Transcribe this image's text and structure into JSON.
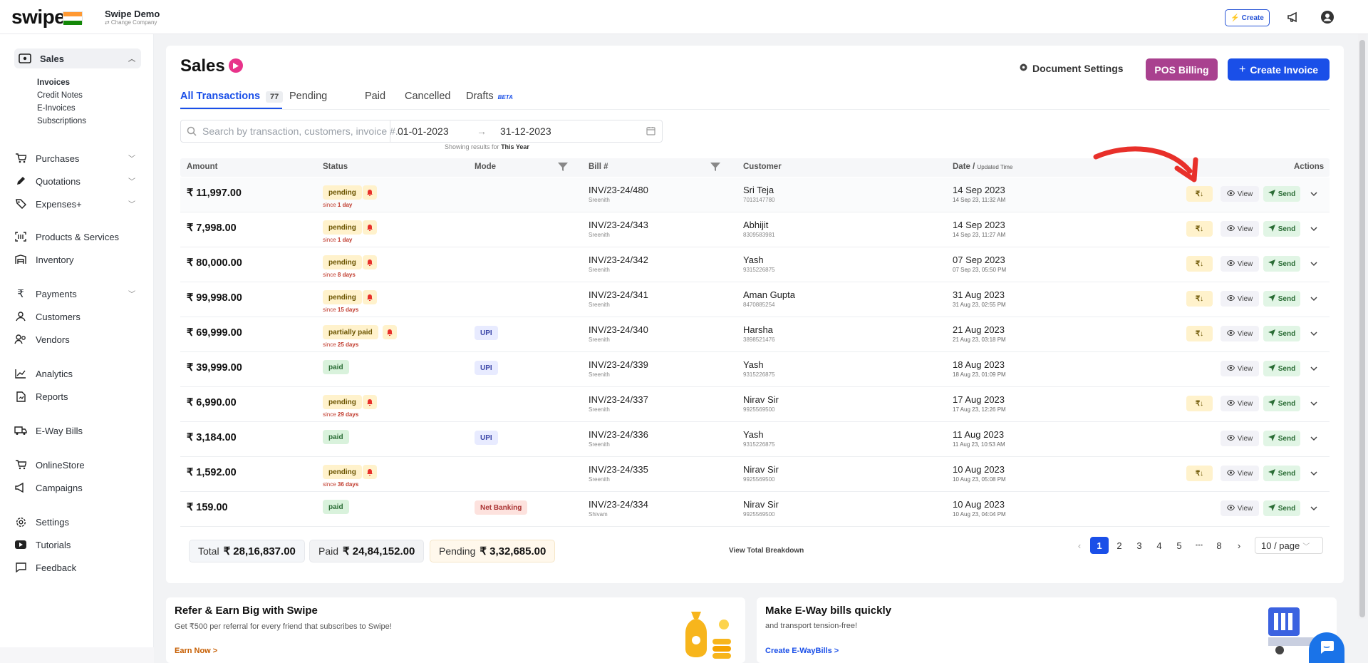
{
  "brand": {
    "logo_text": "swipe",
    "company_name": "Swipe Demo",
    "change_company": "⇄ Change Company"
  },
  "topbar": {
    "create_label": "Create"
  },
  "sidebar": {
    "items": [
      {
        "label": "Sales",
        "icon": "sales-icon"
      },
      {
        "label": "Purchases",
        "icon": "cart-icon"
      },
      {
        "label": "Quotations",
        "icon": "pen-icon"
      },
      {
        "label": "Expenses+",
        "icon": "tag-icon"
      },
      {
        "label": "Products & Services",
        "icon": "barcode-icon"
      },
      {
        "label": "Inventory",
        "icon": "warehouse-icon"
      },
      {
        "label": "Payments",
        "icon": "rupee-icon"
      },
      {
        "label": "Customers",
        "icon": "user-icon"
      },
      {
        "label": "Vendors",
        "icon": "users-icon"
      },
      {
        "label": "Analytics",
        "icon": "chart-icon"
      },
      {
        "label": "Reports",
        "icon": "report-icon"
      },
      {
        "label": "E-Way Bills",
        "icon": "truck-icon"
      },
      {
        "label": "OnlineStore",
        "icon": "store-icon"
      },
      {
        "label": "Campaigns",
        "icon": "megaphone-icon"
      },
      {
        "label": "Settings",
        "icon": "gear-icon"
      },
      {
        "label": "Tutorials",
        "icon": "youtube-icon"
      },
      {
        "label": "Feedback",
        "icon": "feedback-icon"
      }
    ],
    "sales_sub": [
      "Invoices",
      "Credit Notes",
      "E-Invoices",
      "Subscriptions"
    ]
  },
  "page": {
    "title": "Sales",
    "document_settings": "Document Settings",
    "pos_billing": "POS Billing",
    "create_invoice": "Create Invoice",
    "tabs": [
      {
        "label": "All Transactions",
        "count": "77"
      },
      {
        "label": "Pending"
      },
      {
        "label": "Paid"
      },
      {
        "label": "Cancelled"
      },
      {
        "label": "Drafts",
        "badge": "BETA"
      }
    ],
    "search_placeholder": "Search by transaction, customers, invoice #...",
    "date_from": "01-01-2023",
    "date_arrow": "→",
    "date_to": "31-12-2023",
    "showing_prefix": "Showing results for",
    "showing_period": "This Year"
  },
  "table": {
    "headers": {
      "amount": "Amount",
      "status": "Status",
      "mode": "Mode",
      "bill": "Bill #",
      "customer": "Customer",
      "date": "Date /",
      "date_small": "Updated Time",
      "actions": "Actions"
    },
    "rows": [
      {
        "amount": "₹ 11,997.00",
        "status": "pending",
        "since_pre": "since",
        "since": "1 day",
        "mode": "",
        "bill": "INV/23-24/480",
        "bill_by": "Sreenith",
        "customer": "Sri Teja",
        "phone": "7013147780",
        "date": "14 Sep 2023",
        "updated": "14 Sep 23, 11:32 AM",
        "download": true
      },
      {
        "amount": "₹ 7,998.00",
        "status": "pending",
        "since_pre": "since",
        "since": "1 day",
        "mode": "",
        "bill": "INV/23-24/343",
        "bill_by": "Sreenith",
        "customer": "Abhijit",
        "phone": "8309583981",
        "date": "14 Sep 2023",
        "updated": "14 Sep 23, 11:27 AM",
        "download": true
      },
      {
        "amount": "₹ 80,000.00",
        "status": "pending",
        "since_pre": "since",
        "since": "8 days",
        "mode": "",
        "bill": "INV/23-24/342",
        "bill_by": "Sreenith",
        "customer": "Yash",
        "phone": "9315226875",
        "date": "07 Sep 2023",
        "updated": "07 Sep 23, 05:50 PM",
        "download": true
      },
      {
        "amount": "₹ 99,998.00",
        "status": "pending",
        "since_pre": "since",
        "since": "15 days",
        "mode": "",
        "bill": "INV/23-24/341",
        "bill_by": "Sreenith",
        "customer": "Aman Gupta",
        "phone": "8470885254",
        "date": "31 Aug 2023",
        "updated": "31 Aug 23, 02:55 PM",
        "download": true
      },
      {
        "amount": "₹ 69,999.00",
        "status": "partially paid",
        "since_pre": "since",
        "since": "25 days",
        "mode": "UPI",
        "bill": "INV/23-24/340",
        "bill_by": "Sreenith",
        "customer": "Harsha",
        "phone": "3898521476",
        "date": "21 Aug 2023",
        "updated": "21 Aug 23, 03:18 PM",
        "download": true
      },
      {
        "amount": "₹ 39,999.00",
        "status": "paid",
        "since_pre": "",
        "since": "",
        "mode": "UPI",
        "bill": "INV/23-24/339",
        "bill_by": "Sreenith",
        "customer": "Yash",
        "phone": "9315226875",
        "date": "18 Aug 2023",
        "updated": "18 Aug 23, 01:09 PM",
        "download": false
      },
      {
        "amount": "₹ 6,990.00",
        "status": "pending",
        "since_pre": "since",
        "since": "29 days",
        "mode": "",
        "bill": "INV/23-24/337",
        "bill_by": "Sreenith",
        "customer": "Nirav Sir",
        "phone": "9925569500",
        "date": "17 Aug 2023",
        "updated": "17 Aug 23, 12:26 PM",
        "download": true
      },
      {
        "amount": "₹ 3,184.00",
        "status": "paid",
        "since_pre": "",
        "since": "",
        "mode": "UPI",
        "bill": "INV/23-24/336",
        "bill_by": "Sreenith",
        "customer": "Yash",
        "phone": "9315226875",
        "date": "11 Aug 2023",
        "updated": "11 Aug 23, 10:53 AM",
        "download": false
      },
      {
        "amount": "₹ 1,592.00",
        "status": "pending",
        "since_pre": "since",
        "since": "36 days",
        "mode": "",
        "bill": "INV/23-24/335",
        "bill_by": "Sreenith",
        "customer": "Nirav Sir",
        "phone": "9925569500",
        "date": "10 Aug 2023",
        "updated": "10 Aug 23, 05:08 PM",
        "download": true
      },
      {
        "amount": "₹ 159.00",
        "status": "paid",
        "since_pre": "",
        "since": "",
        "mode": "Net Banking",
        "bill": "INV/23-24/334",
        "bill_by": "Shivam",
        "customer": "Nirav Sir",
        "phone": "9925569500",
        "date": "10 Aug 2023",
        "updated": "10 Aug 23, 04:04 PM",
        "download": false
      }
    ],
    "actions": {
      "download": "₹↓",
      "view": "View",
      "send": "Send"
    }
  },
  "totals": {
    "total_label": "Total",
    "total_value": "₹ 28,16,837.00",
    "paid_label": "Paid",
    "paid_value": "₹ 24,84,152.00",
    "pending_label": "Pending",
    "pending_value": "₹ 3,32,685.00",
    "breakdown_link": "View Total Breakdown"
  },
  "pagination": {
    "pages": [
      "1",
      "2",
      "3",
      "4",
      "5",
      "•••",
      "8"
    ],
    "current": "1",
    "per_page": "10 / page"
  },
  "promos": [
    {
      "title": "Refer & Earn Big with Swipe",
      "subtitle": "Get ₹500 per referral for every friend that subscribes to Swipe!",
      "link": "Earn Now >"
    },
    {
      "title": "Make E-Way bills quickly",
      "subtitle": "and transport tension-free!",
      "link": "Create E-WayBills >"
    }
  ],
  "colors": {
    "primary": "#1a4fe8",
    "pos": "#a9418f",
    "pending": "#fff2cc",
    "paid": "#d9f2dc",
    "annotation_arrow": "#e8302a"
  }
}
